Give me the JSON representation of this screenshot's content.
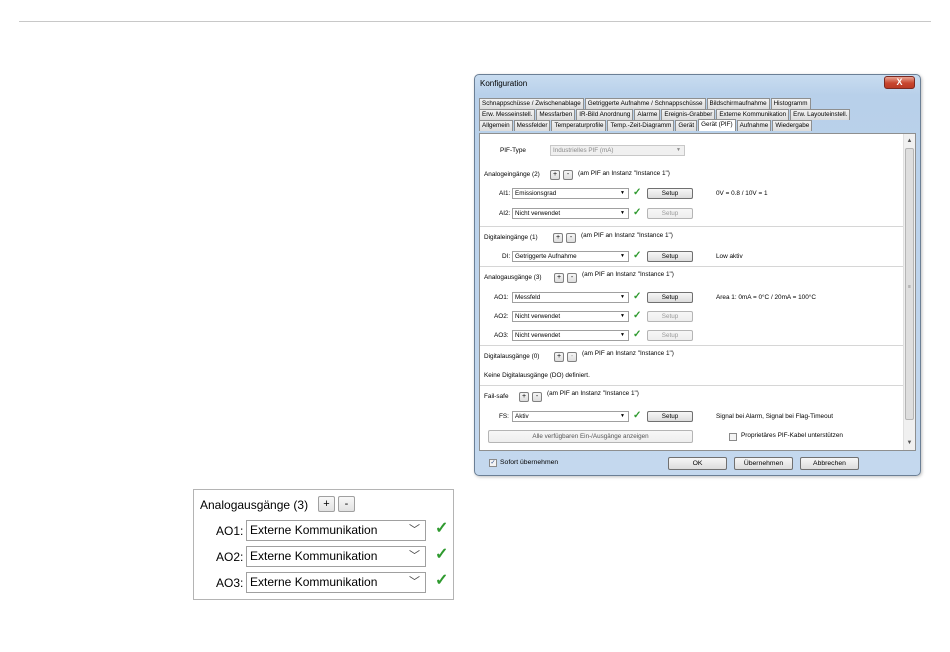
{
  "dialog": {
    "title": "Konfiguration",
    "close_label": "X",
    "tabs_row1": [
      "Schnappschüsse / Zwischenablage",
      "Getriggerte Aufnahme / Schnappschüsse",
      "Bildschirmaufnahme",
      "Histogramm"
    ],
    "tabs_row2": [
      "Erw. Messeinstell.",
      "Messfarben",
      "IR-Bild Anordnung",
      "Alarme",
      "Ereignis-Grabber",
      "Externe Kommunikation",
      "Erw. Layouteinstell."
    ],
    "tabs_row3": [
      "Allgemein",
      "Messfelder",
      "Temperaturprofile",
      "Temp.-Zeit-Diagramm",
      "Gerät",
      "Gerät (PIF)",
      "Aufnahme",
      "Wiedergabe"
    ],
    "active_tab": "Gerät (PIF)",
    "pif_type_label": "PIF-Type",
    "pif_type_value": "Industrielles PIF (mA)",
    "setup_label": "Setup",
    "plus": "+",
    "minus": "-",
    "analog_in": {
      "title": "Analogeingänge (2)",
      "note": "(am PIF an Instanz \"Instance 1\")",
      "rows": [
        {
          "label": "AI1:",
          "value": "Emissionsgrad",
          "info": "0V = 0.8 / 10V = 1"
        },
        {
          "label": "AI2:",
          "value": "Nicht verwendet",
          "info": ""
        }
      ]
    },
    "digital_in": {
      "title": "Digitaleingänge (1)",
      "note": "(am PIF an Instanz \"Instance 1\")",
      "rows": [
        {
          "label": "DI:",
          "value": "Getriggerte Aufnahme",
          "info": "Low aktiv"
        }
      ]
    },
    "analog_out": {
      "title": "Analogausgänge (3)",
      "note": "(am PIF an Instanz \"Instance 1\")",
      "rows": [
        {
          "label": "AO1:",
          "value": "Messfeld",
          "info": "Area 1: 0mA = 0°C / 20mA = 100°C"
        },
        {
          "label": "AO2:",
          "value": "Nicht verwendet",
          "info": ""
        },
        {
          "label": "AO3:",
          "value": "Nicht verwendet",
          "info": ""
        }
      ]
    },
    "digital_out": {
      "title": "Digitalausgänge (0)",
      "note": "(am PIF an Instanz \"Instance 1\")",
      "empty_text": "Keine Digitalausgänge (DO) definiert."
    },
    "failsafe": {
      "title": "Fail-safe",
      "note": "(am PIF an Instanz \"Instance 1\")",
      "label": "FS:",
      "value": "Aktiv",
      "info": "Signal bei Alarm, Signal bei Flag-Timeout"
    },
    "show_all_button": "Alle verfügbaren Ein-/Ausgänge anzeigen",
    "proprietary_cable_label": "Proprietäres PIF-Kabel unterstützen",
    "apply_immediately_label": "Sofort übernehmen",
    "ok_label": "OK",
    "apply_label": "Übernehmen",
    "cancel_label": "Abbrechen"
  },
  "inset": {
    "title": "Analogausgänge (3)",
    "plus": "+",
    "minus": "-",
    "rows": [
      {
        "label": "AO1:",
        "value": "Externe Kommunikation"
      },
      {
        "label": "AO2:",
        "value": "Externe Kommunikation"
      },
      {
        "label": "AO3:",
        "value": "Externe Kommunikation"
      }
    ]
  },
  "colors": {
    "check": "#2f9a2f",
    "close": "#c8462f",
    "dialog_frame": "#b8d0ea"
  }
}
